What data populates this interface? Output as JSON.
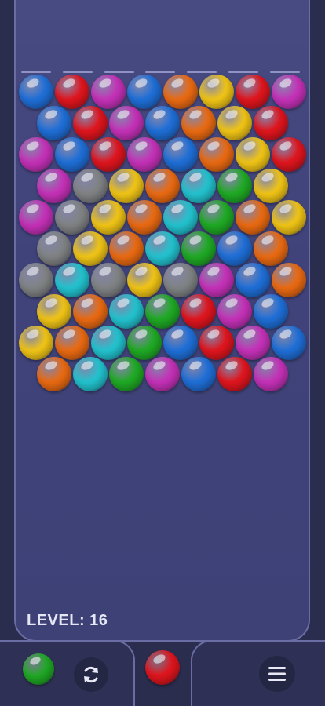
{
  "hud": {
    "level_text": "LEVEL: 16"
  },
  "colors": {
    "blue": "#1f6fd8",
    "red": "#e0151e",
    "magenta": "#c531b8",
    "orange": "#ea6a12",
    "yellow": "#f1c516",
    "gray": "#808384",
    "cyan": "#22c3cf",
    "green": "#1faa24"
  },
  "grid": {
    "rows": [
      [
        "blue",
        "red",
        "magenta",
        "blue",
        "orange",
        "yellow",
        "red",
        "magenta"
      ],
      [
        "blue",
        "red",
        "magenta",
        "blue",
        "orange",
        "yellow",
        "red"
      ],
      [
        "magenta",
        "blue",
        "red",
        "magenta",
        "blue",
        "orange",
        "yellow",
        "red"
      ],
      [
        "magenta",
        "gray",
        "yellow",
        "orange",
        "cyan",
        "green",
        "yellow"
      ],
      [
        "magenta",
        "gray",
        "yellow",
        "orange",
        "cyan",
        "green",
        "orange",
        "yellow"
      ],
      [
        "gray",
        "yellow",
        "orange",
        "cyan",
        "green",
        "blue",
        "orange"
      ],
      [
        "gray",
        "cyan",
        "gray",
        "yellow",
        "gray",
        "magenta",
        "blue",
        "orange"
      ],
      [
        "yellow",
        "orange",
        "cyan",
        "green",
        "red",
        "magenta",
        "blue"
      ],
      [
        "yellow",
        "orange",
        "cyan",
        "green",
        "blue",
        "red",
        "magenta",
        "blue"
      ],
      [
        "orange",
        "cyan",
        "green",
        "magenta",
        "blue",
        "red",
        "magenta"
      ]
    ]
  },
  "shooter": {
    "current_color": "red",
    "next_color": "green"
  },
  "controls": {
    "swap_icon": "swap-icon",
    "menu_icon": "menu-icon"
  }
}
